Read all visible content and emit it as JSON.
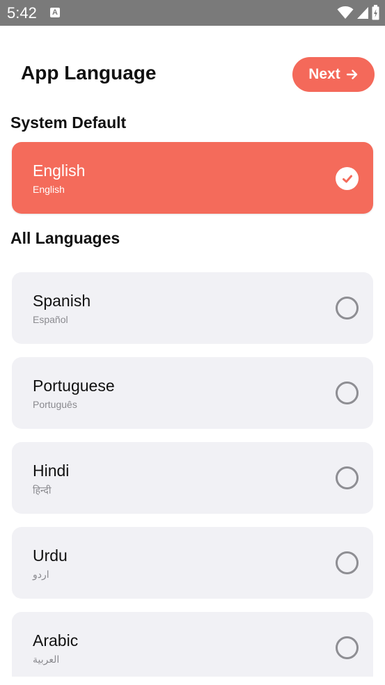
{
  "status_bar": {
    "time": "5:42",
    "notification_badge": "A"
  },
  "header": {
    "title": "App Language",
    "next_label": "Next"
  },
  "system_default": {
    "title": "System Default",
    "language": {
      "name": "English",
      "native": "English",
      "selected": true
    }
  },
  "all_languages": {
    "title": "All Languages",
    "items": [
      {
        "name": "Spanish",
        "native": "Español",
        "selected": false
      },
      {
        "name": "Portuguese",
        "native": "Português",
        "selected": false
      },
      {
        "name": "Hindi",
        "native": "हिन्दी",
        "selected": false
      },
      {
        "name": "Urdu",
        "native": "اردو",
        "selected": false
      },
      {
        "name": "Arabic",
        "native": "العربية",
        "selected": false
      }
    ]
  },
  "colors": {
    "accent": "#f46b5b",
    "card_background": "#f1f1f5",
    "status_bar": "#7a7a7a",
    "text_primary": "#111111",
    "text_secondary": "#8a8a8f"
  },
  "icons": {
    "next": "arrow-right-icon",
    "selected": "check-circle-icon",
    "unselected": "radio-empty-icon",
    "wifi": "wifi-icon",
    "signal": "signal-icon",
    "battery": "battery-icon"
  }
}
